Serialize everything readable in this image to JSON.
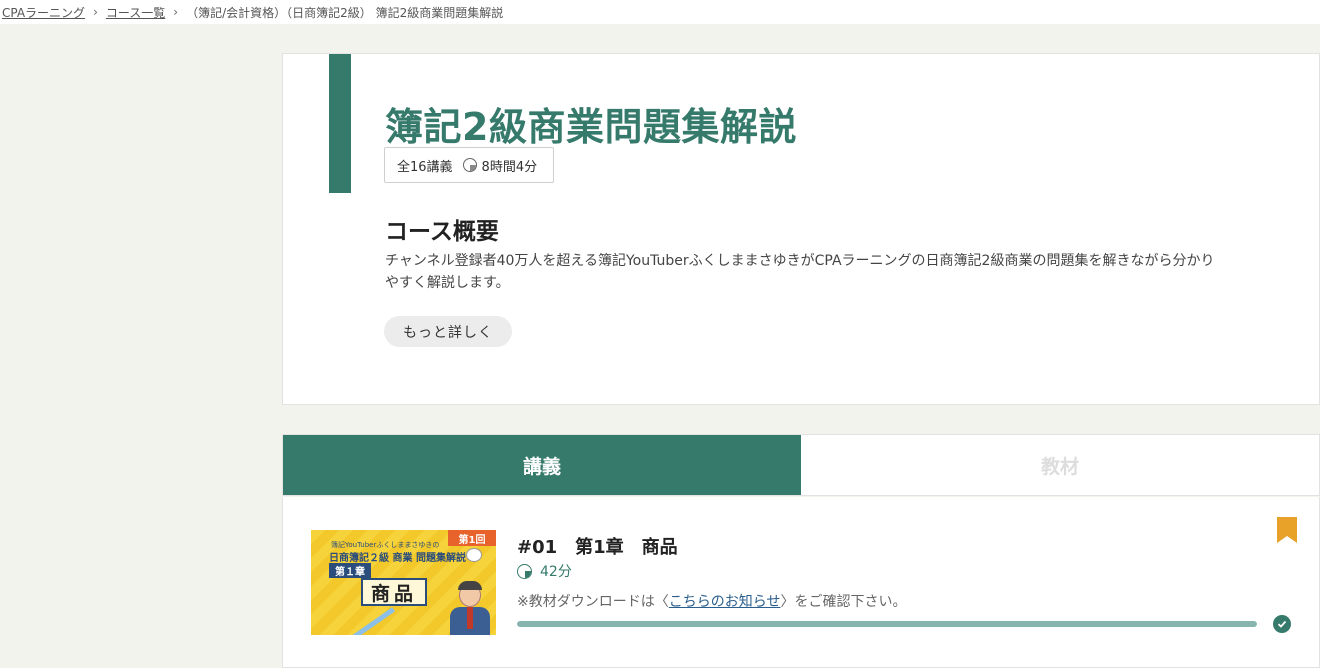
{
  "breadcrumb": {
    "items": [
      "CPAラーニング",
      "コース一覧",
      "（簿記/会計資格）（日商簿記2級） 簿記2級商業問題集解説"
    ],
    "separator": "›"
  },
  "course": {
    "title": "簿記2級商業問題集解説",
    "lecture_count": "全16講義",
    "total_time": "8時間4分",
    "overview_heading": "コース概要",
    "overview_text": "チャンネル登録者40万人を超える簿記YouTuberふくしままさゆきがCPAラーニングの日商簿記2級商業の問題集を解きながら分かりやすく解説します。",
    "more_label": "もっと詳しく"
  },
  "tabs": [
    {
      "label": "講義",
      "active": true
    },
    {
      "label": "教材",
      "active": false
    }
  ],
  "lectures": [
    {
      "title": "#01　第1章　商品",
      "duration": "42分",
      "notice_prefix": "※教材ダウンロードは〈",
      "notice_link": "こちらのお知らせ",
      "notice_suffix": "〉をご確認下さい。",
      "progress": 1.0,
      "completed": true,
      "bookmarked": true,
      "thumbnail": {
        "tag": "第1回",
        "line1": "簿記YouTuberふくしままさゆきの",
        "line2": "日商簿記２級 商業 問題集解説",
        "chapter": "第１章",
        "big": "商品"
      }
    }
  ],
  "colors": {
    "accent": "#367a6b",
    "progress": "#85b5ac",
    "bookmark": "#e8a22a",
    "link": "#2a5e8c"
  }
}
